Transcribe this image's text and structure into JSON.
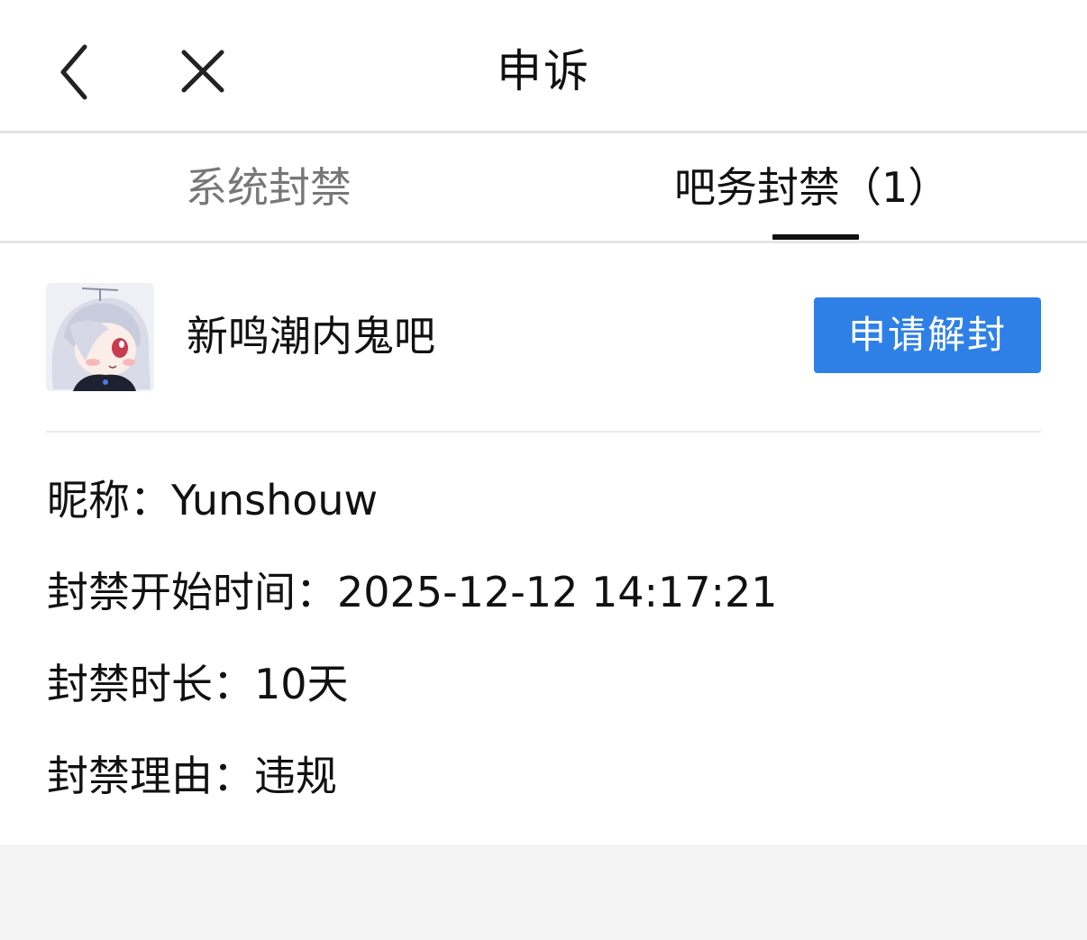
{
  "header": {
    "title": "申诉",
    "back_icon": "chevron-left-icon",
    "close_icon": "close-icon"
  },
  "tabs": [
    {
      "label": "系统封禁",
      "active": false
    },
    {
      "label": "吧务封禁（1）",
      "active": true
    }
  ],
  "forum": {
    "name": "新鸣潮内鬼吧",
    "avatar": "forum-avatar",
    "unban_button_label": "申请解封",
    "button_color": "#2f80e6"
  },
  "ban_info": {
    "nickname_label": "昵称：",
    "nickname_value": "Yunshouw",
    "start_time_label": "封禁开始时间：",
    "start_time_value": "2025-12-12 14:17:21",
    "duration_label": "封禁时长：",
    "duration_value": "10天",
    "reason_label": "封禁理由：",
    "reason_value": "违规"
  }
}
